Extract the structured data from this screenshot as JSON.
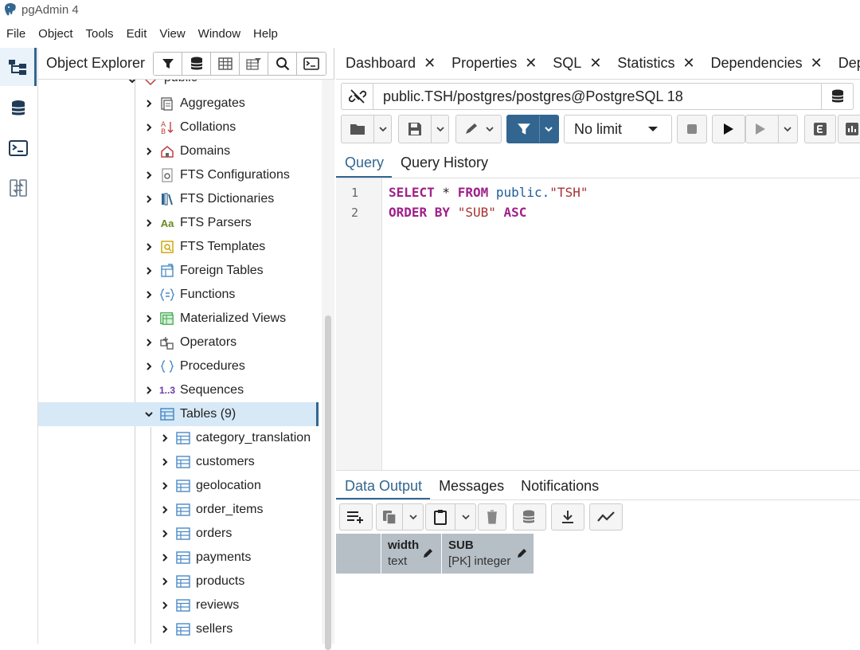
{
  "window": {
    "title": "pgAdmin 4"
  },
  "menu": [
    "File",
    "Object",
    "Tools",
    "Edit",
    "View",
    "Window",
    "Help"
  ],
  "explorer": {
    "title": "Object Explorer",
    "partial_node": "public",
    "nodes": [
      {
        "label": "Aggregates",
        "icon": "aggregates-icon"
      },
      {
        "label": "Collations",
        "icon": "collations-icon"
      },
      {
        "label": "Domains",
        "icon": "domains-icon"
      },
      {
        "label": "FTS Configurations",
        "icon": "fts-configurations-icon"
      },
      {
        "label": "FTS Dictionaries",
        "icon": "fts-dictionaries-icon"
      },
      {
        "label": "FTS Parsers",
        "icon": "fts-parsers-icon",
        "glyph": "Aa"
      },
      {
        "label": "FTS Templates",
        "icon": "fts-templates-icon"
      },
      {
        "label": "Foreign Tables",
        "icon": "foreign-tables-icon"
      },
      {
        "label": "Functions",
        "icon": "functions-icon"
      },
      {
        "label": "Materialized Views",
        "icon": "materialized-views-icon"
      },
      {
        "label": "Operators",
        "icon": "operators-icon"
      },
      {
        "label": "Procedures",
        "icon": "procedures-icon"
      },
      {
        "label": "Sequences",
        "icon": "sequences-icon",
        "glyph": "1..3"
      },
      {
        "label": "Tables (9)",
        "icon": "tables-icon",
        "expanded": true
      }
    ],
    "tables": [
      "category_translation",
      "customers",
      "geolocation",
      "order_items",
      "orders",
      "payments",
      "products",
      "reviews",
      "sellers"
    ]
  },
  "tabs": [
    "Dashboard",
    "Properties",
    "SQL",
    "Statistics",
    "Dependencies",
    "Depend"
  ],
  "connection": {
    "text": "public.TSH/postgres/postgres@PostgreSQL 18"
  },
  "query_toolbar": {
    "limit": "No limit"
  },
  "query_tabs": [
    "Query",
    "Query History"
  ],
  "editor": {
    "line_numbers": [
      "1",
      "2"
    ],
    "line1": {
      "kw1": "SELECT",
      "star": " * ",
      "kw2": "FROM",
      "schema": " public.",
      "table": "\"TSH\""
    },
    "line2": {
      "kw1": "ORDER BY",
      "col": " \"SUB\" ",
      "kw2": "ASC"
    }
  },
  "result_tabs": [
    "Data Output",
    "Messages",
    "Notifications"
  ],
  "columns": [
    {
      "name": "width",
      "type": "text"
    },
    {
      "name": "SUB",
      "type": "[PK] integer"
    }
  ],
  "colors": {
    "accent": "#326690",
    "selected_row": "#d7e9f7",
    "grid_header": "#b6bec6"
  }
}
